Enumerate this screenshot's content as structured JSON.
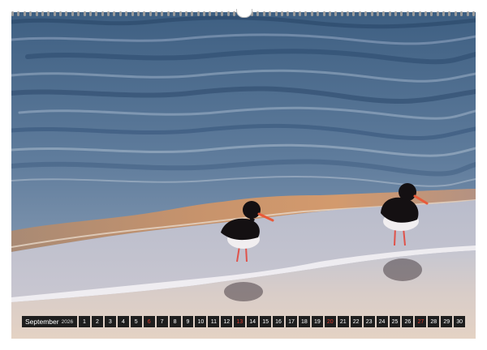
{
  "calendar": {
    "month": "September",
    "year": "2026",
    "days": [
      "1",
      "2",
      "3",
      "4",
      "5",
      "6",
      "7",
      "8",
      "9",
      "10",
      "11",
      "12",
      "13",
      "14",
      "15",
      "16",
      "17",
      "18",
      "19",
      "20",
      "21",
      "22",
      "23",
      "24",
      "25",
      "26",
      "27",
      "28",
      "29",
      "30"
    ],
    "sundays": [
      "6",
      "13",
      "20",
      "27"
    ]
  },
  "colors": {
    "strip_background": "#1e1e1e",
    "day_text": "#ffffff",
    "sunday_text": "#e23a2e"
  }
}
